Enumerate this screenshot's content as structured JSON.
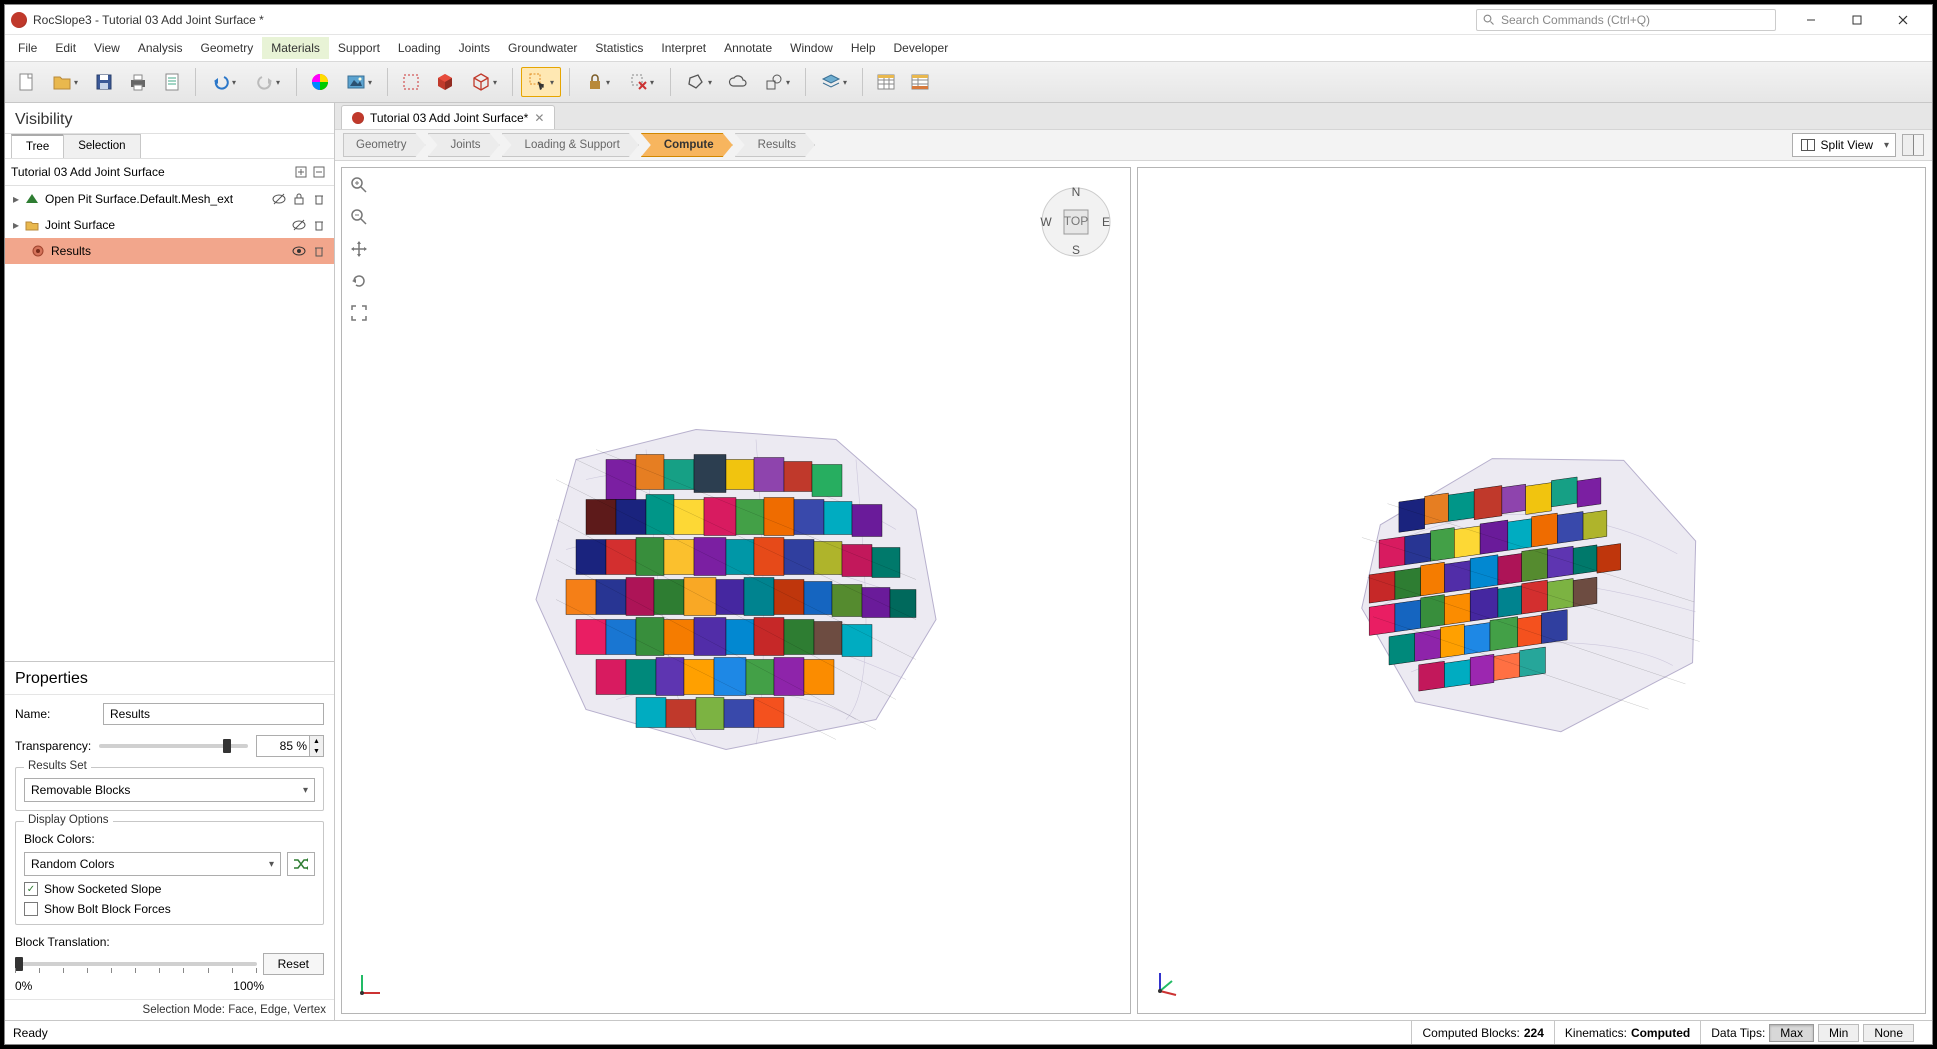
{
  "window": {
    "title": "RocSlope3 - Tutorial 03 Add Joint Surface *",
    "search_placeholder": "Search Commands (Ctrl+Q)"
  },
  "menu": [
    "File",
    "Edit",
    "View",
    "Analysis",
    "Geometry",
    "Materials",
    "Support",
    "Loading",
    "Joints",
    "Groundwater",
    "Statistics",
    "Interpret",
    "Annotate",
    "Window",
    "Help",
    "Developer"
  ],
  "doc_tab": {
    "label": "Tutorial 03 Add Joint Surface*"
  },
  "workflow": {
    "steps": [
      "Geometry",
      "Joints",
      "Loading & Support",
      "Compute",
      "Results"
    ],
    "active_index": 3,
    "split_view_label": "Split View"
  },
  "visibility": {
    "title": "Visibility",
    "tabs": [
      "Tree",
      "Selection"
    ],
    "active_tab": 0,
    "root": "Tutorial 03 Add Joint Surface",
    "items": [
      {
        "label": "Open Pit Surface.Default.Mesh_ext",
        "icon": "mesh"
      },
      {
        "label": "Joint Surface",
        "icon": "folder"
      },
      {
        "label": "Results",
        "icon": "results",
        "selected": true
      }
    ]
  },
  "properties": {
    "title": "Properties",
    "name_label": "Name:",
    "name_value": "Results",
    "transparency_label": "Transparency:",
    "transparency_value": "85 %",
    "transparency_pct": 85,
    "results_set": {
      "legend": "Results Set",
      "value": "Removable Blocks"
    },
    "display_options": {
      "legend": "Display Options",
      "block_colors_label": "Block Colors:",
      "block_colors_value": "Random Colors",
      "show_socketed": "Show Socketed Slope",
      "show_socketed_checked": true,
      "show_bolt": "Show Bolt Block Forces",
      "show_bolt_checked": false
    },
    "block_translation_label": "Block Translation:",
    "reset_label": "Reset",
    "range_min": "0%",
    "range_max": "100%",
    "selection_mode": "Selection Mode: Face, Edge, Vertex"
  },
  "compass": {
    "N": "N",
    "S": "S",
    "E": "E",
    "W": "W",
    "top": "TOP"
  },
  "status": {
    "ready": "Ready",
    "computed_blocks_label": "Computed Blocks:",
    "computed_blocks_value": "224",
    "kinematics_label": "Kinematics:",
    "kinematics_value": "Computed",
    "data_tips_label": "Data Tips:",
    "btn_max": "Max",
    "btn_min": "Min",
    "btn_none": "None"
  }
}
